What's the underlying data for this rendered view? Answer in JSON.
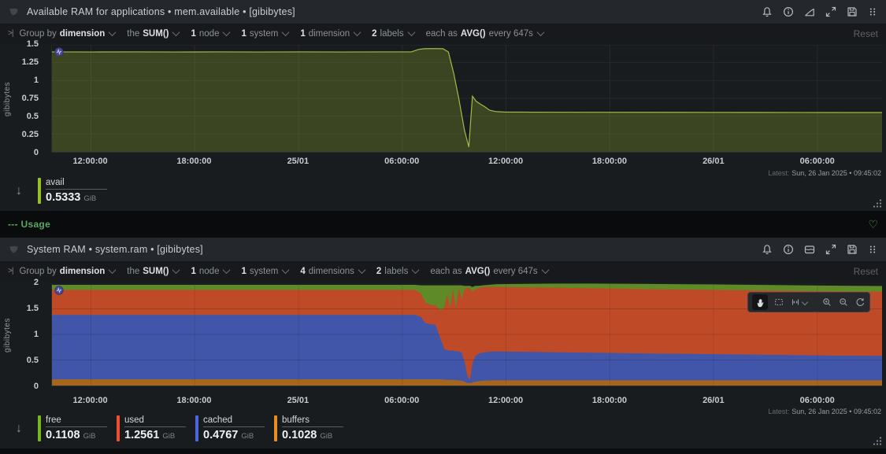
{
  "section": {
    "label": "--- Usage"
  },
  "charts": [
    {
      "title": "Available RAM for applications • mem.available • [gibibytes]",
      "ribbon": {
        "collapse_glyph": ">|",
        "group_by_label": "Group by",
        "group_by_value": "dimension",
        "the_label": "the",
        "sum_value": "SUM()",
        "node_count": "1",
        "node_label": "node",
        "system_count": "1",
        "system_label": "system",
        "dimension_count": "1",
        "dimension_label": "dimension",
        "labels_count": "2",
        "labels_label": "labels",
        "each_as_label": "each as",
        "avg_value": "AVG()",
        "every_label": "every 647s",
        "reset_label": "Reset"
      },
      "ylabel": "gibibytes",
      "yticks": [
        "1.5",
        "1.25",
        "1",
        "0.75",
        "0.5",
        "0.25",
        "0"
      ],
      "xticks": [
        "12:00:00",
        "18:00:00",
        "25/01",
        "06:00:00",
        "12:00:00",
        "18:00:00",
        "26/01",
        "06:00:00"
      ],
      "latest_label": "Latest:",
      "latest_value": "Sun, 26 Jan 2025 • 09:45:02",
      "legend": {
        "items": [
          {
            "label": "avail",
            "value": "0.5333",
            "unit": "GiB",
            "color": "#96c023"
          }
        ]
      }
    },
    {
      "title": "System RAM • system.ram • [gibibytes]",
      "ribbon": {
        "collapse_glyph": ">|",
        "group_by_label": "Group by",
        "group_by_value": "dimension",
        "the_label": "the",
        "sum_value": "SUM()",
        "node_count": "1",
        "node_label": "node",
        "system_count": "1",
        "system_label": "system",
        "dimension_count": "4",
        "dimension_label": "dimensions",
        "labels_count": "2",
        "labels_label": "labels",
        "each_as_label": "each as",
        "avg_value": "AVG()",
        "every_label": "every 647s",
        "reset_label": "Reset"
      },
      "ylabel": "gibibytes",
      "yticks": [
        "2",
        "1.5",
        "1",
        "0.5",
        "0"
      ],
      "xticks": [
        "12:00:00",
        "18:00:00",
        "25/01",
        "06:00:00",
        "12:00:00",
        "18:00:00",
        "26/01",
        "06:00:00"
      ],
      "latest_label": "Latest:",
      "latest_value": "Sun, 26 Jan 2025 • 09:45:02",
      "legend": {
        "items": [
          {
            "label": "free",
            "value": "0.1108",
            "unit": "GiB",
            "color": "#74b71e"
          },
          {
            "label": "used",
            "value": "1.2561",
            "unit": "GiB",
            "color": "#ee5130"
          },
          {
            "label": "cached",
            "value": "0.4767",
            "unit": "GiB",
            "color": "#4a67e0"
          },
          {
            "label": "buffers",
            "value": "0.1028",
            "unit": "GiB",
            "color": "#ea8d1f"
          }
        ]
      }
    }
  ],
  "chart_data": [
    {
      "type": "area",
      "title": "Available RAM for applications",
      "context": "mem.available",
      "ylabel": "gibibytes",
      "ylim": [
        0,
        1.5
      ],
      "ygrid": [
        0.25,
        0.5,
        0.75,
        1,
        1.25,
        1.5
      ],
      "grid_color": "#26292d",
      "xtick_fracs": [
        0.047,
        0.172,
        0.297,
        0.422,
        0.547,
        0.672,
        0.797,
        0.922
      ],
      "series": [
        {
          "name": "avail",
          "latest": 0.5333,
          "color": "#a2bc48",
          "fill": "rgba(138,165,40,0.30)",
          "points": [
            [
              0,
              1.401
            ],
            [
              0.05,
              1.4
            ],
            [
              0.1,
              1.401
            ],
            [
              0.15,
              1.4
            ],
            [
              0.2,
              1.401
            ],
            [
              0.25,
              1.4
            ],
            [
              0.3,
              1.401
            ],
            [
              0.35,
              1.4
            ],
            [
              0.4,
              1.401
            ],
            [
              0.433,
              1.402
            ],
            [
              0.442,
              1.438
            ],
            [
              0.449,
              1.446
            ],
            [
              0.46,
              1.447
            ],
            [
              0.471,
              1.446
            ],
            [
              0.4775,
              1.4
            ],
            [
              0.484,
              1.1
            ],
            [
              0.49,
              0.75
            ],
            [
              0.497,
              0.3
            ],
            [
              0.5022,
              0.068
            ],
            [
              0.5042,
              0.4
            ],
            [
              0.5065,
              0.78
            ],
            [
              0.511,
              0.71
            ],
            [
              0.516,
              0.67
            ],
            [
              0.521,
              0.635
            ],
            [
              0.527,
              0.585
            ],
            [
              0.534,
              0.566
            ],
            [
              0.545,
              0.558
            ],
            [
              0.58,
              0.556
            ],
            [
              0.65,
              0.555
            ],
            [
              0.75,
              0.554
            ],
            [
              0.85,
              0.553
            ],
            [
              0.95,
              0.552
            ],
            [
              1,
              0.552
            ]
          ]
        }
      ]
    },
    {
      "type": "stacked-area",
      "title": "System RAM",
      "context": "system.ram",
      "ylabel": "gibibytes",
      "ylim": [
        0,
        2
      ],
      "ygrid": [
        0.5,
        1,
        1.5,
        2
      ],
      "grid_color": "#26292d",
      "grid_overlay": true,
      "xtick_fracs": [
        0.047,
        0.172,
        0.297,
        0.422,
        0.547,
        0.672,
        0.797,
        0.922
      ],
      "x": [
        0,
        0.05,
        0.1,
        0.15,
        0.2,
        0.25,
        0.3,
        0.35,
        0.4,
        0.425,
        0.438,
        0.4445,
        0.45,
        0.456,
        0.462,
        0.468,
        0.4725,
        0.476,
        0.4795,
        0.483,
        0.4865,
        0.49,
        0.4935,
        0.497,
        0.5005,
        0.5035,
        0.5065,
        0.51,
        0.514,
        0.519,
        0.526,
        0.535,
        0.55,
        0.6,
        0.65,
        0.72,
        0.8,
        0.88,
        0.95,
        1
      ],
      "series": [
        {
          "name": "buffers",
          "latest": 0.1028,
          "fill": "#a8661c",
          "values": [
            0.12,
            0.12,
            0.12,
            0.12,
            0.12,
            0.12,
            0.12,
            0.12,
            0.12,
            0.12,
            0.12,
            0.12,
            0.12,
            0.12,
            0.12,
            0.12,
            0.115,
            0.11,
            0.11,
            0.11,
            0.105,
            0.1,
            0.095,
            0.075,
            0.05,
            0.048,
            0.06,
            0.075,
            0.085,
            0.095,
            0.1,
            0.102,
            0.103,
            0.103,
            0.103,
            0.103,
            0.103,
            0.103,
            0.103,
            0.103
          ]
        },
        {
          "name": "cached",
          "latest": 0.4767,
          "fill": "#4156a8",
          "values": [
            1.26,
            1.26,
            1.26,
            1.26,
            1.26,
            1.26,
            1.26,
            1.26,
            1.26,
            1.26,
            1.26,
            1.22,
            1.1,
            1.08,
            1.07,
            0.8,
            0.6,
            0.58,
            0.57,
            0.58,
            0.56,
            0.57,
            0.55,
            0.4,
            0.14,
            0.06,
            0.38,
            0.5,
            0.54,
            0.55,
            0.56,
            0.565,
            0.56,
            0.55,
            0.54,
            0.525,
            0.51,
            0.495,
            0.482,
            0.477
          ]
        },
        {
          "name": "used",
          "latest": 1.2561,
          "fill": "#bf4a28",
          "values": [
            0.49,
            0.49,
            0.49,
            0.49,
            0.49,
            0.49,
            0.49,
            0.49,
            0.49,
            0.49,
            0.49,
            0.46,
            0.4,
            0.38,
            0.38,
            0.55,
            0.8,
            1.1,
            0.85,
            1.2,
            0.85,
            1.25,
            1.05,
            1.4,
            1.72,
            1.79,
            1.4,
            1.3,
            1.28,
            1.28,
            1.27,
            1.265,
            1.262,
            1.26,
            1.261,
            1.258,
            1.259,
            1.257,
            1.256,
            1.256
          ]
        },
        {
          "name": "free",
          "latest": 0.1108,
          "fill": "#5e8a28",
          "values": [
            0.1,
            0.1,
            0.1,
            0.1,
            0.1,
            0.1,
            0.1,
            0.1,
            0.1,
            0.1,
            0.1,
            0.16,
            0.34,
            0.38,
            0.39,
            0.49,
            0.445,
            0.17,
            0.43,
            0.07,
            0.445,
            0.04,
            0.265,
            0.075,
            0.04,
            0.052,
            0.09,
            0.075,
            0.045,
            0.035,
            0.04,
            0.05,
            0.06,
            0.08,
            0.09,
            0.1,
            0.105,
            0.108,
            0.11,
            0.111
          ]
        }
      ]
    }
  ]
}
